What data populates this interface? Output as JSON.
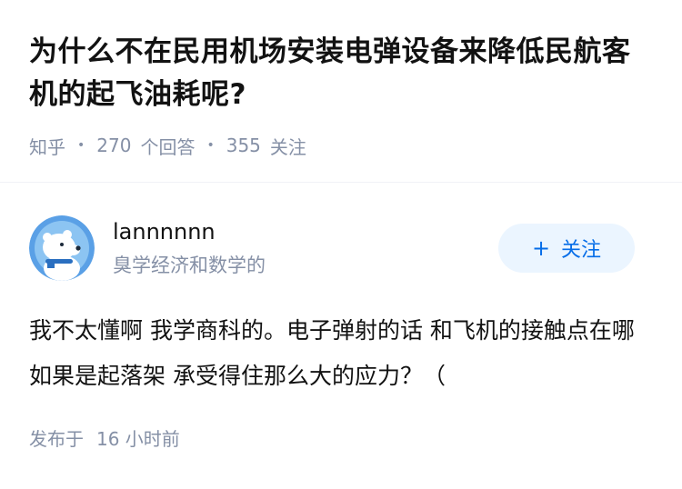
{
  "question": {
    "title": "为什么不在民用机场安装电弹设备来降低民航客机的起飞油耗呢?",
    "source": "知乎",
    "answer_count": "270",
    "answer_label": "个回答",
    "follower_count": "355",
    "follower_label": "关注"
  },
  "answer": {
    "author_name": "lannnnnn",
    "author_bio": "臭学经济和数学的",
    "follow_label": "关注",
    "content": "我不太懂啊 我学商科的。电子弹射的话 和飞机的接触点在哪 如果是起落架 承受得住那么大的应力？（",
    "published_label": "发布于",
    "published_time": "16 小时前"
  },
  "colors": {
    "accent": "#056de8",
    "follow_bg": "#ebf5ff",
    "meta_text": "#8590a6",
    "avatar_bg": "#5aa0e6"
  }
}
